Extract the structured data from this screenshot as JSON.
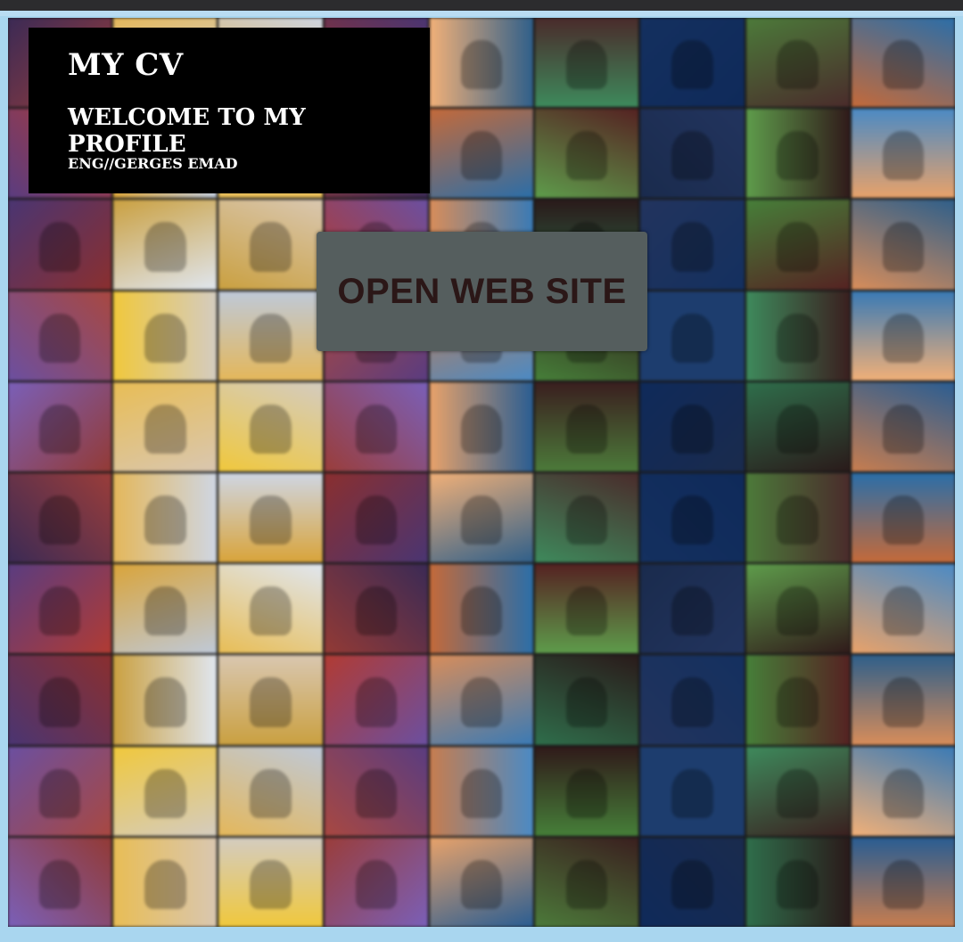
{
  "header": {
    "title": "MY CV",
    "subtitle": "WELCOME TO MY PROFILE",
    "author": "ENG//GERGES EMAD"
  },
  "button": {
    "label": "OPEN WEB SITE"
  },
  "colors": {
    "background": "#a9d6ef",
    "header_bg": "#000000",
    "header_text": "#ffffff",
    "button_bg": "#555e5e",
    "button_text": "#2b1717"
  },
  "mosaic": {
    "rows": 10,
    "cols": 9,
    "palette": [
      "#3b2a55",
      "#c46a3a",
      "#2f5f8a",
      "#9a3d3a",
      "#4c7a3a",
      "#d9c7b0",
      "#1d3d6e",
      "#e4b75a",
      "#552222",
      "#6b4fa0",
      "#e8a26a",
      "#2b6ea8",
      "#b13b33",
      "#3e8a5c",
      "#cfd6e3",
      "#1a2b4d",
      "#f0c83c",
      "#3a1f1f",
      "#5a3c80",
      "#d88d5a",
      "#3a7ab5",
      "#8a2f2f",
      "#5e9c4b",
      "#bfc9d8",
      "#0f2a5a",
      "#d9a43a",
      "#2a1a1a",
      "#7a5fb8",
      "#f1b078",
      "#4b8ac4",
      "#a84841",
      "#2f6e4b",
      "#e0e6ef",
      "#22345e",
      "#e8bd55",
      "#4a2b2b",
      "#4a3572",
      "#c77d4f",
      "#2a5d92",
      "#933a35",
      "#467f39",
      "#d4ccc0",
      "#14305f",
      "#caa040",
      "#301a1a"
    ]
  }
}
